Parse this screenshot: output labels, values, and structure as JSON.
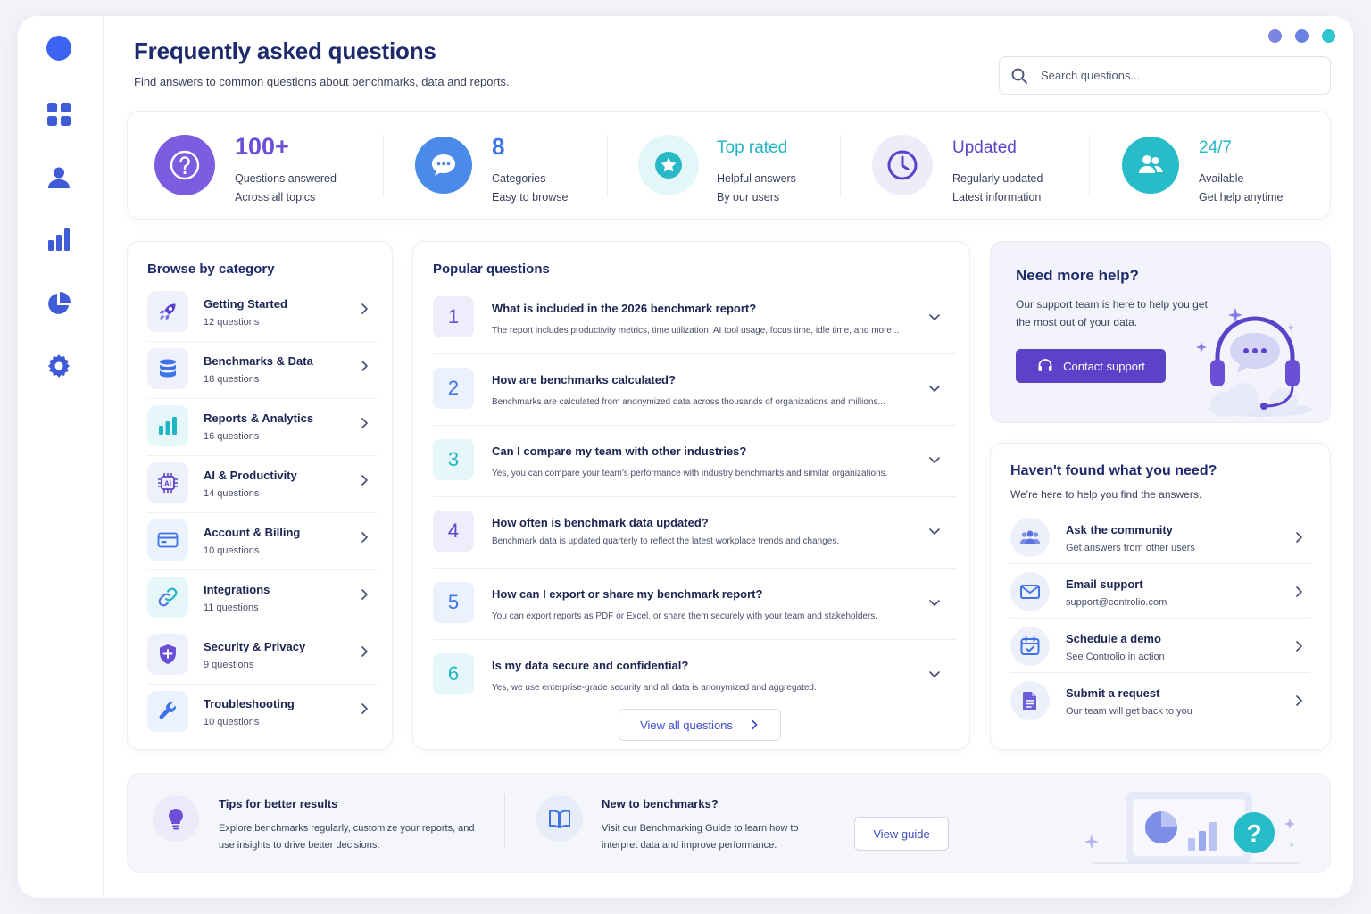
{
  "header": {
    "title": "Frequently asked questions",
    "subtitle": "Find answers to common questions about benchmarks, data and reports.",
    "search_placeholder": "Search questions..."
  },
  "colors": {
    "accent_blue": "#3c63f2",
    "primary_purple": "#5b42c9",
    "teal": "#22b8c8",
    "navy_text": "#1d2a6b"
  },
  "sidebar": {
    "items": [
      {
        "icon": "dashboard-grid-icon"
      },
      {
        "icon": "user-icon"
      },
      {
        "icon": "bar-chart-icon"
      },
      {
        "icon": "pie-chart-icon"
      },
      {
        "icon": "gear-icon"
      }
    ]
  },
  "stats": [
    {
      "icon": "question-circle-icon",
      "value": "100+",
      "line1": "Questions answered",
      "line2": "Across all topics",
      "color": "#6b4fd6"
    },
    {
      "icon": "chat-bubble-icon",
      "value": "8",
      "line1": "Categories",
      "line2": "Easy to browse",
      "color": "#3c74e8"
    },
    {
      "icon": "star-badge-icon",
      "value": "Top rated",
      "line1": "Helpful answers",
      "line2": "By our users",
      "color": "#20b5c4"
    },
    {
      "icon": "clock-icon",
      "value": "Updated",
      "line1": "Regularly updated",
      "line2": "Latest information",
      "color": "#5b42c9"
    },
    {
      "icon": "users-icon",
      "value": "24/7",
      "line1": "Available",
      "line2": "Get help anytime",
      "color": "#22b8c8"
    }
  ],
  "categories": {
    "title": "Browse by category",
    "items": [
      {
        "icon": "rocket-icon",
        "name": "Getting Started",
        "count": "12 questions"
      },
      {
        "icon": "database-icon",
        "name": "Benchmarks & Data",
        "count": "18 questions"
      },
      {
        "icon": "bar-chart-icon",
        "name": "Reports & Analytics",
        "count": "16 questions"
      },
      {
        "icon": "ai-chip-icon",
        "name": "AI & Productivity",
        "count": "14 questions"
      },
      {
        "icon": "credit-card-icon",
        "name": "Account & Billing",
        "count": "10 questions"
      },
      {
        "icon": "link-icon",
        "name": "Integrations",
        "count": "11 questions"
      },
      {
        "icon": "shield-icon",
        "name": "Security & Privacy",
        "count": "9 questions"
      },
      {
        "icon": "wrench-icon",
        "name": "Troubleshooting",
        "count": "10 questions"
      }
    ]
  },
  "questions": {
    "title": "Popular questions",
    "items": [
      {
        "num": "1",
        "q": "What is included in the 2026 benchmark report?",
        "a": "The report includes productivity metrics, time utilization, AI tool usage, focus time, idle time, and more...",
        "color": "#6b4fd6",
        "bg": "#efedfb"
      },
      {
        "num": "2",
        "q": "How are benchmarks calculated?",
        "a": "Benchmarks are calculated from anonymized data across thousands of organizations and millions...",
        "color": "#3c74e8",
        "bg": "#ebf1fd"
      },
      {
        "num": "3",
        "q": "Can I compare my team with other industries?",
        "a": "Yes, you can compare your team's performance with industry benchmarks and similar organizations.",
        "color": "#20b5c4",
        "bg": "#e6f7f9"
      },
      {
        "num": "4",
        "q": "How often is benchmark data updated?",
        "a": "Benchmark data is updated quarterly to reflect the latest workplace trends and changes.",
        "color": "#5b42c9",
        "bg": "#efedfb"
      },
      {
        "num": "5",
        "q": "How can I export or share my benchmark report?",
        "a": "You can export reports as PDF or Excel, or share them securely with your team and stakeholders.",
        "color": "#3c74e8",
        "bg": "#ebf1fd"
      },
      {
        "num": "6",
        "q": "Is my data secure and confidential?",
        "a": "Yes, we use enterprise-grade security and all data is anonymized and aggregated.",
        "color": "#20b5c4",
        "bg": "#e6f7f9"
      }
    ],
    "view_all": "View all questions"
  },
  "help": {
    "title": "Need more help?",
    "desc": "Our support team is here to help you get the most out of your data.",
    "button": "Contact support"
  },
  "need": {
    "title": "Haven't found what you need?",
    "subtitle": "We're here to help you find the answers.",
    "items": [
      {
        "icon": "community-icon",
        "name": "Ask the community",
        "sub": "Get answers from other users"
      },
      {
        "icon": "email-icon",
        "name": "Email support",
        "sub": "support@controlio.com"
      },
      {
        "icon": "calendar-icon",
        "name": "Schedule a demo",
        "sub": "See Controlio in action"
      },
      {
        "icon": "document-icon",
        "name": "Submit a request",
        "sub": "Our team will get back to you"
      }
    ]
  },
  "tips": {
    "tip_title": "Tips for better results",
    "tip_text": "Explore benchmarks regularly, customize your reports, and use insights to drive better decisions.",
    "guide_title": "New to benchmarks?",
    "guide_text": "Visit our Benchmarking Guide to learn how to interpret data and improve performance.",
    "guide_button": "View guide"
  }
}
